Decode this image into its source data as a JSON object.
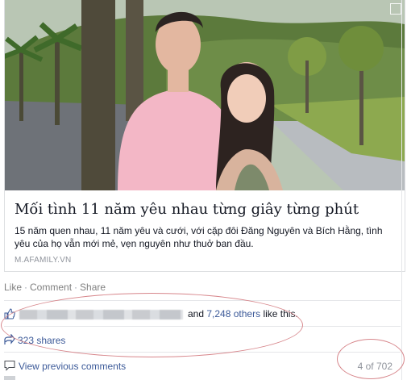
{
  "post": {
    "link_preview": {
      "title": "Mối tình 11 năm yêu nhau từng giây từng phút",
      "description": "15 năm quen nhau, 11 năm yêu và cưới, với cặp đôi Đăng Nguyên và Bích Hằng, tình yêu của họ vẫn mới mẻ, vẹn nguyên như thuở ban đầu.",
      "domain": "M.AFAMILY.VN"
    },
    "actions": {
      "like": "Like",
      "comment": "Comment",
      "share": "Share",
      "separator": "·"
    },
    "likes": {
      "icon": "thumbs-up-icon",
      "and": "and",
      "others": "7,248 others",
      "suffix": "like this."
    },
    "shares": {
      "icon": "share-icon",
      "label": "323 shares"
    },
    "comments": {
      "icon": "comment-icon",
      "view_previous": "View previous comments",
      "pager": "4 of 702"
    }
  },
  "colors": {
    "link": "#3b5998",
    "muted": "#90949c",
    "annotation": "#d7868b"
  }
}
